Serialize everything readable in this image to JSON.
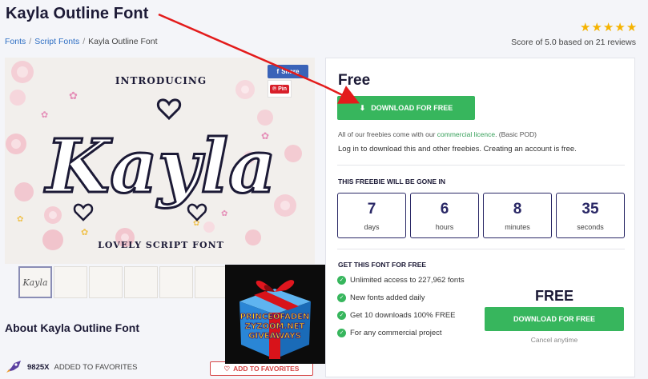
{
  "page": {
    "title": "Kayla Outline Font",
    "rating_stars": 5,
    "rating_text": "Score of 5.0 based on 21 reviews"
  },
  "breadcrumb": {
    "items": [
      "Fonts",
      "Script Fonts",
      "Kayla Outline Font"
    ],
    "separator": "/"
  },
  "hero": {
    "introducing": "INTRODUCING",
    "name": "Kayla",
    "tagline": "LOVELY SCRIPT FONT",
    "share_label": "Share",
    "pin_label": "Pin"
  },
  "thumbnails": [
    "Kayla",
    "",
    "",
    "",
    "",
    ""
  ],
  "about": {
    "heading": "About Kayla Outline Font",
    "favorites_count": "9825X",
    "favorites_label": "ADDED TO FAVORITES",
    "add_favorites_button": "ADD TO FAVORITES"
  },
  "giveaway": {
    "line1": "PRINCEOFADEN",
    "line2": "ZYZOOM.NET",
    "line3": "GIVEAWAYS"
  },
  "panel": {
    "price_heading": "Free",
    "download_button": "DOWNLOAD FOR FREE",
    "note_prefix": "All of our freebies come with our ",
    "note_link": "commercial licence",
    "note_suffix": ". (Basic POD)",
    "login_note": "Log in to download this and other freebies. Creating an account is free.",
    "gone_heading": "THIS FREEBIE WILL BE GONE IN",
    "countdown": [
      {
        "value": "7",
        "unit": "days"
      },
      {
        "value": "6",
        "unit": "hours"
      },
      {
        "value": "8",
        "unit": "minutes"
      },
      {
        "value": "35",
        "unit": "seconds"
      }
    ],
    "get_heading": "GET THIS FONT FOR FREE",
    "features": [
      "Unlimited access to 227,962 fonts",
      "New fonts added daily",
      "Get 10 downloads 100% FREE",
      "For any commercial project"
    ],
    "free_big": "FREE",
    "download_button_2": "DOWNLOAD FOR FREE",
    "cancel_text": "Cancel anytime"
  },
  "colors": {
    "accent_green": "#37b65d",
    "navy": "#2a2866",
    "link_blue": "#2f6fc4",
    "arrow_red": "#e31b1b"
  }
}
